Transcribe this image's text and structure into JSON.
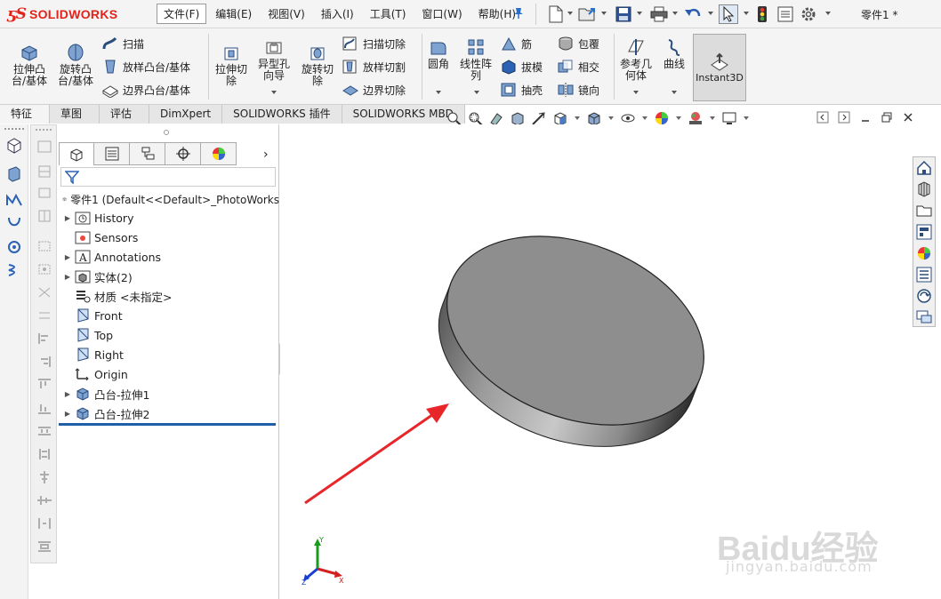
{
  "app": {
    "logo_ds": "ƽS",
    "logo_name": "SOLIDWORKS",
    "document_title": "零件1 *"
  },
  "menus": [
    {
      "label": "文件(F)"
    },
    {
      "label": "编辑(E)"
    },
    {
      "label": "视图(V)"
    },
    {
      "label": "插入(I)"
    },
    {
      "label": "工具(T)"
    },
    {
      "label": "窗口(W)"
    },
    {
      "label": "帮助(H)"
    }
  ],
  "toolbar_icons": [
    "new-file-icon",
    "open-file-icon",
    "save-icon",
    "print-icon",
    "undo-icon",
    "select-icon",
    "traffic-light-icon",
    "options-gear-icon"
  ],
  "command_manager": {
    "extrude_boss": "拉伸凸\n台/基体",
    "revolve_boss": "旋转凸\n台/基体",
    "sweep": "扫描",
    "loft_boss": "放样凸台/基体",
    "boundary_boss": "边界凸台/基体",
    "extrude_cut": "拉伸切\n除",
    "hole_wizard": "异型孔\n向导",
    "revolve_cut": "旋转切\n除",
    "swept_cut": "扫描切除",
    "lofted_cut": "放样切割",
    "boundary_cut": "边界切除",
    "fillet": "圆角",
    "linear_pattern": "线性阵\n列",
    "rib": "筋",
    "draft": "拔模",
    "shell": "抽壳",
    "wrap": "包覆",
    "intersect": "相交",
    "mirror": "镜向",
    "reference_geometry": "参考几\n何体",
    "curves": "曲线",
    "instant3d": "Instant3D"
  },
  "tabs": [
    {
      "label": "特征",
      "active": true
    },
    {
      "label": "草图",
      "active": false
    },
    {
      "label": "评估",
      "active": false
    },
    {
      "label": "DimXpert",
      "active": false
    },
    {
      "label": "SOLIDWORKS 插件",
      "active": false
    },
    {
      "label": "SOLIDWORKS MBD",
      "active": false
    }
  ],
  "feature_manager": {
    "root_label": "零件1  (Default<<Default>_PhotoWorks",
    "tree": [
      {
        "label": "History",
        "expandable": true,
        "icon": "history-folder-icon"
      },
      {
        "label": "Sensors",
        "expandable": false,
        "icon": "sensors-folder-icon"
      },
      {
        "label": "Annotations",
        "expandable": true,
        "icon": "annotations-icon"
      },
      {
        "label": "实体(2)",
        "expandable": true,
        "icon": "solid-bodies-icon"
      },
      {
        "label": "材质 <未指定>",
        "expandable": false,
        "icon": "material-icon"
      },
      {
        "label": "Front",
        "expandable": false,
        "icon": "plane-icon"
      },
      {
        "label": "Top",
        "expandable": false,
        "icon": "plane-icon"
      },
      {
        "label": "Right",
        "expandable": false,
        "icon": "plane-icon"
      },
      {
        "label": "Origin",
        "expandable": false,
        "icon": "origin-icon"
      },
      {
        "label": "凸台-拉伸1",
        "expandable": true,
        "icon": "boss-extrude-icon"
      },
      {
        "label": "凸台-拉伸2",
        "expandable": true,
        "icon": "boss-extrude-icon"
      }
    ]
  },
  "viewport": {
    "model": "cylinder-disk",
    "annotation_arrow_color": "#e8262a",
    "triad": {
      "x": "X",
      "y": "Y",
      "z": "Z"
    }
  },
  "watermark": {
    "main": "Baidu经验",
    "sub": "jingyan.baidu.com"
  }
}
